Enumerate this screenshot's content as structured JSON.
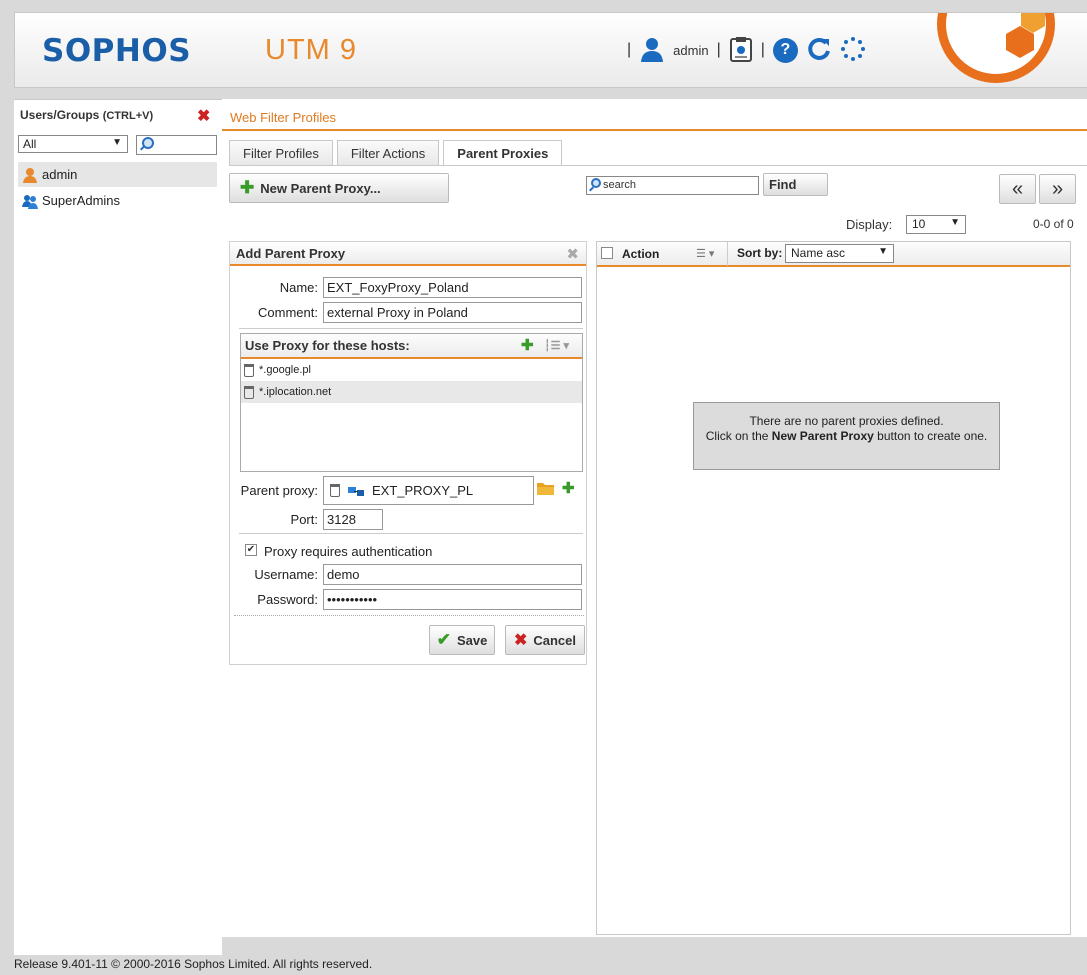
{
  "header": {
    "logo": "SOPHOS",
    "product": "UTM 9",
    "user": "admin",
    "separator": "|"
  },
  "left_panel": {
    "title": "Users/Groups",
    "shortcut": "(CTRL+V)",
    "filter_value": "All",
    "items": [
      {
        "label": "admin"
      },
      {
        "label": "SuperAdmins"
      }
    ]
  },
  "breadcrumb": "Web Filter Profiles",
  "tabs": [
    {
      "label": "Filter Profiles"
    },
    {
      "label": "Filter Actions"
    },
    {
      "label": "Parent Proxies"
    }
  ],
  "toolbar": {
    "new_button": "New Parent Proxy...",
    "search_value": "search",
    "find_button": "Find",
    "prev": "«",
    "next": "»",
    "display_label": "Display:",
    "display_value": "10",
    "count": "0-0 of 0"
  },
  "form": {
    "title": "Add Parent Proxy",
    "name_label": "Name:",
    "name_value": "EXT_FoxyProxy_Poland",
    "comment_label": "Comment:",
    "comment_value": "external Proxy in Poland",
    "hosts_title": "Use Proxy for these hosts:",
    "hosts": [
      "*.google.pl",
      "*.iplocation.net"
    ],
    "parent_proxy_label": "Parent proxy:",
    "parent_proxy_value": "EXT_PROXY_PL",
    "port_label": "Port:",
    "port_value": "3128",
    "auth_label": "Proxy requires authentication",
    "auth_checked": true,
    "username_label": "Username:",
    "username_value": "demo",
    "password_label": "Password:",
    "password_value": "•••••••••••",
    "save_button": "Save",
    "cancel_button": "Cancel"
  },
  "list": {
    "action_label": "Action",
    "sortby_label": "Sort by:",
    "sortby_value": "Name asc",
    "empty_line1": "There are no parent proxies defined.",
    "empty_line2_pre": "Click on the",
    "empty_line2_bold": "New Parent Proxy",
    "empty_line2_post": "button to create one."
  },
  "footer": "Release 9.401-11  © 2000-2016 Sophos Limited. All rights reserved.",
  "colors": {
    "accent": "#e88a2a",
    "brand": "#1a5ea8",
    "orange_text": "#e07a1f"
  }
}
